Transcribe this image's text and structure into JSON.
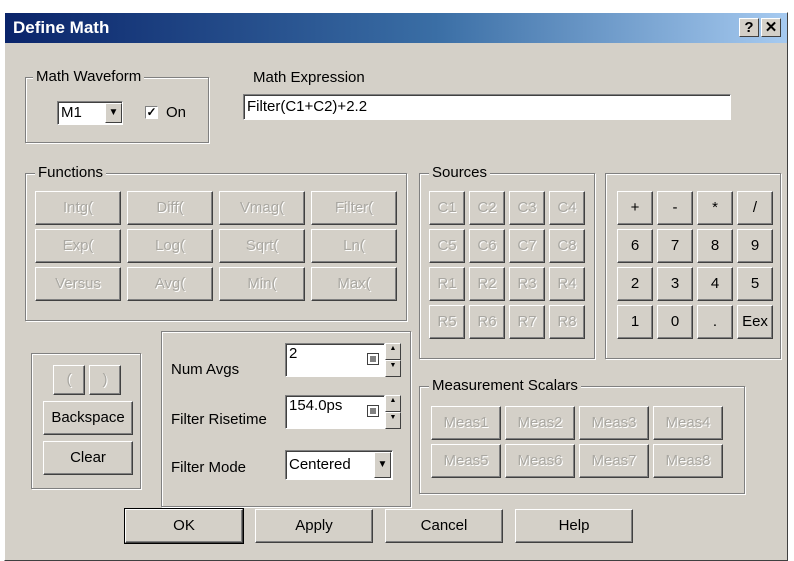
{
  "window": {
    "title": "Define Math",
    "help_glyph": "?",
    "close_glyph": "✕"
  },
  "math_waveform": {
    "legend": "Math Waveform",
    "selected": "M1",
    "on_label": "On",
    "on_checked": true,
    "check_glyph": "✓",
    "arrow_glyph": "▼"
  },
  "math_expression": {
    "label": "Math Expression",
    "value": "Filter(C1+C2)+2.2"
  },
  "functions": {
    "legend": "Functions",
    "items": [
      "Intg(",
      "Diff(",
      "Vmag(",
      "Filter(",
      "Exp(",
      "Log(",
      "Sqrt(",
      "Ln(",
      "Versus",
      "Avg(",
      "Min(",
      "Max("
    ]
  },
  "sources": {
    "legend": "Sources",
    "items": [
      "C1",
      "C2",
      "C3",
      "C4",
      "C5",
      "C6",
      "C7",
      "C8",
      "R1",
      "R2",
      "R3",
      "R4",
      "R5",
      "R6",
      "R7",
      "R8"
    ]
  },
  "keypad": {
    "keys": [
      "+",
      "-",
      "*",
      "/",
      "6",
      "7",
      "8",
      "9",
      "2",
      "3",
      "4",
      "5",
      "1",
      "0",
      ".",
      "Eex"
    ]
  },
  "edit": {
    "open_paren": "(",
    "close_paren": ")",
    "backspace": "Backspace",
    "clear": "Clear"
  },
  "settings": {
    "num_avgs_label": "Num Avgs",
    "num_avgs_value": "2",
    "filter_risetime_label": "Filter Risetime",
    "filter_risetime_value": "154.0ps",
    "filter_mode_label": "Filter Mode",
    "filter_mode_value": "Centered",
    "spin_up": "▲",
    "spin_down": "▼",
    "arrow_glyph": "▼"
  },
  "measurement_scalars": {
    "legend": "Measurement Scalars",
    "items": [
      "Meas1",
      "Meas2",
      "Meas3",
      "Meas4",
      "Meas5",
      "Meas6",
      "Meas7",
      "Meas8"
    ]
  },
  "footer": {
    "ok": "OK",
    "apply": "Apply",
    "cancel": "Cancel",
    "help": "Help"
  }
}
